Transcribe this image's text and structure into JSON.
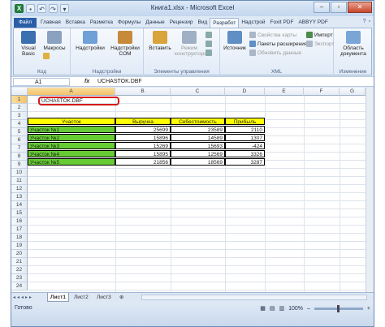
{
  "window": {
    "title": "Книга1.xlsx - Microsoft Excel"
  },
  "tabs": [
    "Файл",
    "Главная",
    "Вставка",
    "Разметка",
    "Формулы",
    "Данные",
    "Рецензир",
    "Вид",
    "Разработ",
    "Надстрой",
    "Foxit PDF",
    "ABBYY PDF"
  ],
  "ribbon": {
    "code": {
      "label": "Код",
      "vb": "Visual Basic",
      "macros": "Макросы"
    },
    "addins": {
      "label": "Надстройки",
      "addins": "Надстройки",
      "com": "Надстройки COM"
    },
    "controls": {
      "label": "Элементы управления",
      "insert": "Вставить",
      "design": "Режим конструктора"
    },
    "xml": {
      "label": "XML",
      "source": "Источник",
      "map_props": "Свойства карты",
      "exp_packs": "Пакеты расширения",
      "refresh": "Обновить данные",
      "import": "Импорт",
      "export": "Экспорт"
    },
    "modify": {
      "label": "Изменение",
      "doc_panel": "Область документа"
    }
  },
  "formula_bar": {
    "name_box": "A1",
    "fx": "fx",
    "content": "UCHASTOK.DBF"
  },
  "columns": [
    "A",
    "B",
    "C",
    "D",
    "E",
    "F",
    "G"
  ],
  "rows": [
    "1",
    "2",
    "3",
    "4",
    "5",
    "6",
    "7",
    "8",
    "9",
    "10",
    "11",
    "12",
    "13",
    "14",
    "15",
    "16",
    "17",
    "18",
    "19",
    "20",
    "21",
    "22",
    "23",
    "24"
  ],
  "cells": {
    "a1": "UCHASTOK.DBF",
    "headers": [
      "Участок",
      "Выручка",
      "Себестоимость",
      "Прибыль"
    ],
    "data": [
      [
        "Участок №1",
        "25699",
        "23589",
        "2110"
      ],
      [
        "Участок №2",
        "15896",
        "14589",
        "1307"
      ],
      [
        "Участок №3",
        "15269",
        "15693",
        "-424"
      ],
      [
        "Участок №4",
        "15895",
        "12569",
        "3326"
      ],
      [
        "Участок №5",
        "21856",
        "18569",
        "3287"
      ]
    ]
  },
  "sheets": [
    "Лист1",
    "Лист2",
    "Лист3"
  ],
  "status": {
    "ready": "Готово",
    "zoom": "100%"
  },
  "colors": {
    "yellow": "#ffff00",
    "green": "#66cc33",
    "highlight": "#d41a1a"
  }
}
